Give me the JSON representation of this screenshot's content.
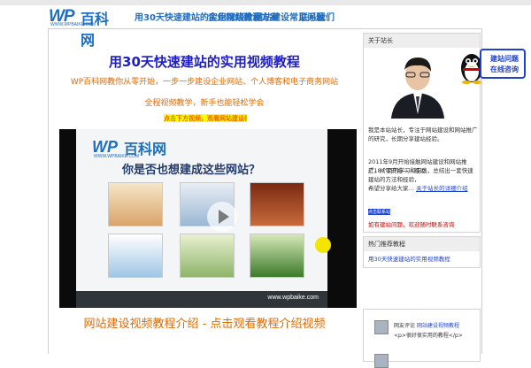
{
  "header": {
    "logo_letters": "WP",
    "logo_cn": "百科网",
    "logo_url": "WWW.WPBAIKE.COM",
    "nav": [
      "用30天快速建站的实用视频教程",
      "企业网站建设方案",
      "网站建设常见问题",
      "联系我们"
    ]
  },
  "main": {
    "title": "用30天快速建站的实用视频教程",
    "subtitle1": "WP百科网教你从零开始，一步一步建设企业网站、个人博客和电子商务网站",
    "subtitle2": "全程视频教学，新手也能轻松学会",
    "highlight": "点击下方视频，观看网站建设视频教程详细介绍内容",
    "video": {
      "logo_letters": "WP",
      "logo_cn": "百科网",
      "logo_url": "WWW.WPBAIKE.COM",
      "question": "你是否也想建成这些网站？",
      "footer_url": "www.wpbaike.com"
    },
    "caption": "网站建设视频教程介绍 - 点击观看教程介绍视频"
  },
  "sidebar": {
    "about_title": "关于站长",
    "about_text1": "我是本站站长，专注于网站建设和网站推广的研究，长期分享建站经验。",
    "about_text2a": "2011年9月开始接触网站建设和网站推广，从零开始——经过",
    "about_text2b": "近18个月的学习和实践，总结出一套快速建站的方法和经验，",
    "about_text2c": "希望分享给大家…",
    "about_link": "关于站长的详细介绍",
    "button_link": "点击联系站长",
    "red_line": "如有建站问题，欢迎随时联系咨询",
    "recommend_title": "热门推荐教程",
    "recommend_link": "用30天快速建站的实用视频教程",
    "comment_user": "网友评论",
    "comment_link": "网站建设视频教程",
    "comment_text": "<p>很好很实用的教程</p>"
  },
  "float": {
    "consult_text": "建站问题在线咨询"
  }
}
